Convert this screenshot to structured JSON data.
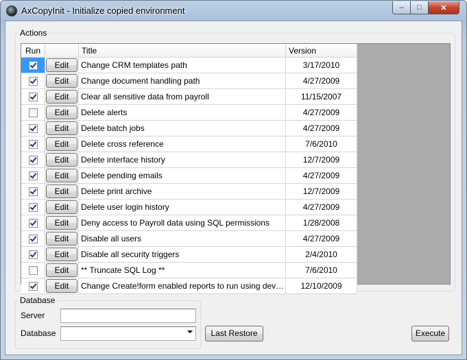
{
  "window": {
    "title": "AxCopyInit - Initialize copied environment"
  },
  "caption_buttons": {
    "minimize": "–",
    "maximize": "□",
    "close": "✕"
  },
  "actions": {
    "group_label": "Actions",
    "columns": [
      "Run",
      "",
      "Title",
      "Version"
    ],
    "edit_label": "Edit",
    "rows": [
      {
        "run": true,
        "title": "Change CRM templates path",
        "version": "3/17/2010"
      },
      {
        "run": true,
        "title": "Change document handling path",
        "version": "4/27/2009"
      },
      {
        "run": true,
        "title": "Clear all sensitive data from payroll",
        "version": "11/15/2007"
      },
      {
        "run": false,
        "title": "Delete alerts",
        "version": "4/27/2009"
      },
      {
        "run": true,
        "title": "Delete batch jobs",
        "version": "4/27/2009"
      },
      {
        "run": true,
        "title": "Delete cross reference",
        "version": "7/6/2010"
      },
      {
        "run": true,
        "title": "Delete interface history",
        "version": "12/7/2009"
      },
      {
        "run": true,
        "title": "Delete pending emails",
        "version": "4/27/2009"
      },
      {
        "run": true,
        "title": "Delete print archive",
        "version": "12/7/2009"
      },
      {
        "run": true,
        "title": "Delete user login history",
        "version": "4/27/2009"
      },
      {
        "run": true,
        "title": "Deny access to Payroll data using SQL permissions",
        "version": "1/28/2008"
      },
      {
        "run": true,
        "title": "Disable all users",
        "version": "4/27/2009"
      },
      {
        "run": true,
        "title": "Disable all security triggers",
        "version": "2/4/2010"
      },
      {
        "run": false,
        "title": "** Truncate SQL Log **",
        "version": "7/6/2010"
      },
      {
        "run": true,
        "title": "Change Create!form enabled reports to run using developme...",
        "version": "12/10/2009"
      }
    ]
  },
  "database": {
    "group_label": "Database",
    "server_label": "Server",
    "server_value": "",
    "database_label": "Database",
    "database_value": ""
  },
  "buttons": {
    "last_restore": "Last Restore",
    "execute": "Execute"
  }
}
